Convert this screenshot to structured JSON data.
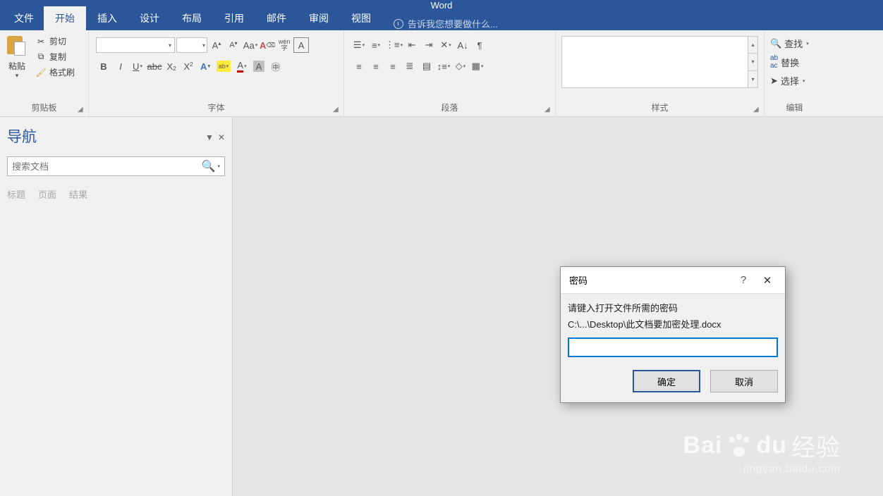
{
  "app_title": "Word",
  "tabs": {
    "file": "文件",
    "home": "开始",
    "insert": "插入",
    "design": "设计",
    "layout": "布局",
    "references": "引用",
    "mailings": "邮件",
    "review": "审阅",
    "view": "视图",
    "tell_me": "告诉我您想要做什么..."
  },
  "clipboard": {
    "paste": "粘贴",
    "cut": "剪切",
    "copy": "复制",
    "format_painter": "格式刷",
    "label": "剪贴板"
  },
  "font": {
    "label": "字体",
    "bold": "B",
    "italic": "I",
    "underline": "U",
    "strike": "abc",
    "sub": "X",
    "sup": "X",
    "grow": "A",
    "shrink": "A",
    "case": "Aa",
    "clear": "A",
    "phonetic": "wén",
    "charborder": "A"
  },
  "paragraph": {
    "label": "段落"
  },
  "styles": {
    "label": "样式"
  },
  "editing": {
    "label": "编辑",
    "find": "查找",
    "replace": "替换",
    "select": "选择"
  },
  "nav": {
    "title": "导航",
    "search_placeholder": "搜索文档",
    "tabs": {
      "headings": "标题",
      "pages": "页面",
      "results": "结果"
    }
  },
  "dialog": {
    "title": "密码",
    "line1": "请键入打开文件所需的密码",
    "line2": "C:\\...\\Desktop\\此文档要加密处理.docx",
    "ok": "确定",
    "cancel": "取消"
  },
  "watermark": {
    "main": "Bai",
    "main2": "du",
    "main3": "经验",
    "sub": "jingyan.baidu.com"
  }
}
